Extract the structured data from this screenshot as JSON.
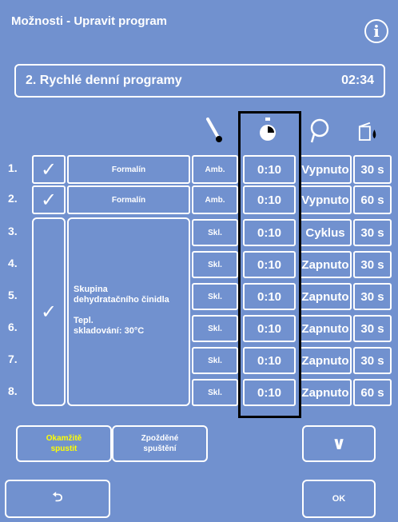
{
  "title": "Možnosti - Upravit program",
  "info_icon": "info-icon",
  "program": {
    "name": "2. Rychlé denní programy",
    "time": "02:34"
  },
  "column_icons": [
    "thermometer-icon",
    "stopwatch-icon",
    "probe-icon",
    "drip-icon"
  ],
  "rows": [
    {
      "num": "1.",
      "reagent": "Formalín",
      "temp": "Amb.",
      "time": "0:10",
      "mode": "Vypnuto",
      "drip": "30 s"
    },
    {
      "num": "2.",
      "reagent": "Formalín",
      "temp": "Amb.",
      "time": "0:10",
      "mode": "Vypnuto",
      "drip": "60 s"
    },
    {
      "num": "3.",
      "temp": "Skl.",
      "time": "0:10",
      "mode": "Cyklus",
      "drip": "30 s"
    },
    {
      "num": "4.",
      "temp": "Skl.",
      "time": "0:10",
      "mode": "Zapnuto",
      "drip": "30 s"
    },
    {
      "num": "5.",
      "temp": "Skl.",
      "time": "0:10",
      "mode": "Zapnuto",
      "drip": "30 s"
    },
    {
      "num": "6.",
      "temp": "Skl.",
      "time": "0:10",
      "mode": "Zapnuto",
      "drip": "30 s"
    },
    {
      "num": "7.",
      "temp": "Skl.",
      "time": "0:10",
      "mode": "Zapnuto",
      "drip": "30 s"
    },
    {
      "num": "8.",
      "temp": "Skl.",
      "time": "0:10",
      "mode": "Zapnuto",
      "drip": "60 s"
    }
  ],
  "group": {
    "line1": "Skupina",
    "line2": "dehydratačního činidla",
    "line3": "Tepl.",
    "line4": "skladování: 30°C"
  },
  "buttons": {
    "immediate_1": "Okamžitě",
    "immediate_2": "spustit",
    "delayed_1": "Zpožděné",
    "delayed_2": "spuštění",
    "down": "∨",
    "back": "⮌",
    "ok": "OK"
  },
  "colors": {
    "background": "#7191cf",
    "accent": "#ffff00",
    "highlight": "#000000"
  }
}
